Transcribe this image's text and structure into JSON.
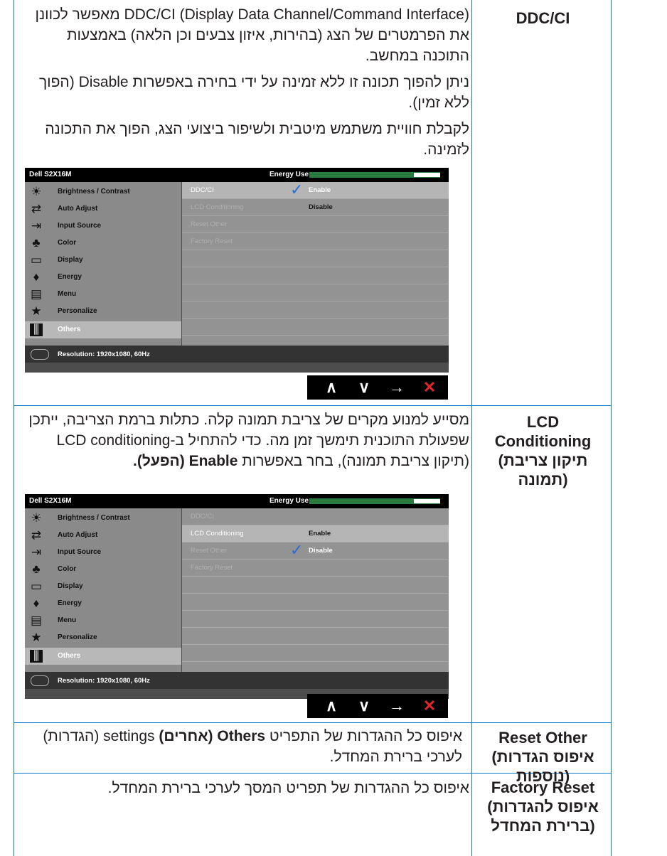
{
  "rows": [
    {
      "term": "DDC/CI",
      "paragraphs": [
        "(Display Data Channel/Command Interface) DDC/CI מאפשר לכוונן את הפרמטרים של הצג (בהירות, איזון צבעים וכן הלאה) באמצעות התוכנה במחשב.",
        "ניתן להפוך תכונה זו ללא זמינה על ידי בחירה באפשרות Disable (הפוך ללא זמין).",
        "לקבלת חוויית משתמש מיטבית ולשיפור ביצועי הצג, הפוך את התכונה לזמינה."
      ]
    },
    {
      "term_line1": "LCD",
      "term_line2": "Conditioning",
      "term_line3": "(תיקון צריבת",
      "term_line4": "תמונה)",
      "text_plain": "מסייע למנוע מקרים של צריבת תמונה קלה. כתלות ברמת הצריבה, ייתכן שפעולת התוכנית תימשך זמן מה. כדי להתחיל ב-LCD conditioning (תיקון צריבת תמונה), בחר באפשרות ",
      "text_bold": "Enable (הפעל)."
    },
    {
      "term_line1": "Reset Other",
      "term_line2": "(איפוס הגדרות",
      "term_line3": "נוספות)",
      "text_a": "איפוס כל ההגדרות של התפריט ",
      "text_bold": "Others (אחרים)",
      "text_b": " settings (הגדרות) לערכי ברירת המחדל."
    },
    {
      "term_line1": "Factory Reset",
      "term_line2": "(איפוס להגדרות",
      "term_line3": "ברירת המחדל)",
      "text": "איפוס כל ההגדרות של תפריט המסך לערכי ברירת המחדל."
    }
  ],
  "osd": {
    "model": "Dell S2X16M",
    "energy_label": "Energy Use",
    "energy_level": 0.2,
    "menu": [
      {
        "label": "Brightness / Contrast",
        "icon": "brightness-icon"
      },
      {
        "label": "Auto Adjust",
        "icon": "auto-adjust-icon"
      },
      {
        "label": "Input Source",
        "icon": "input-source-icon"
      },
      {
        "label": "Color",
        "icon": "color-icon"
      },
      {
        "label": "Display",
        "icon": "display-icon"
      },
      {
        "label": "Energy",
        "icon": "energy-icon"
      },
      {
        "label": "Menu",
        "icon": "menu-icon"
      },
      {
        "label": "Personalize",
        "icon": "personalize-icon"
      },
      {
        "label": "Others",
        "icon": "others-icon"
      }
    ],
    "resolution": "Resolution: 1920x1080, 60Hz",
    "sub_items": [
      "DDC/CI",
      "LCD Conditioning",
      "Reset Other",
      "Factory Reset"
    ],
    "enable": "Enable",
    "disable": "Disable",
    "nav": [
      "up-arrow-icon",
      "down-arrow-icon",
      "right-arrow-icon",
      "close-icon"
    ]
  }
}
